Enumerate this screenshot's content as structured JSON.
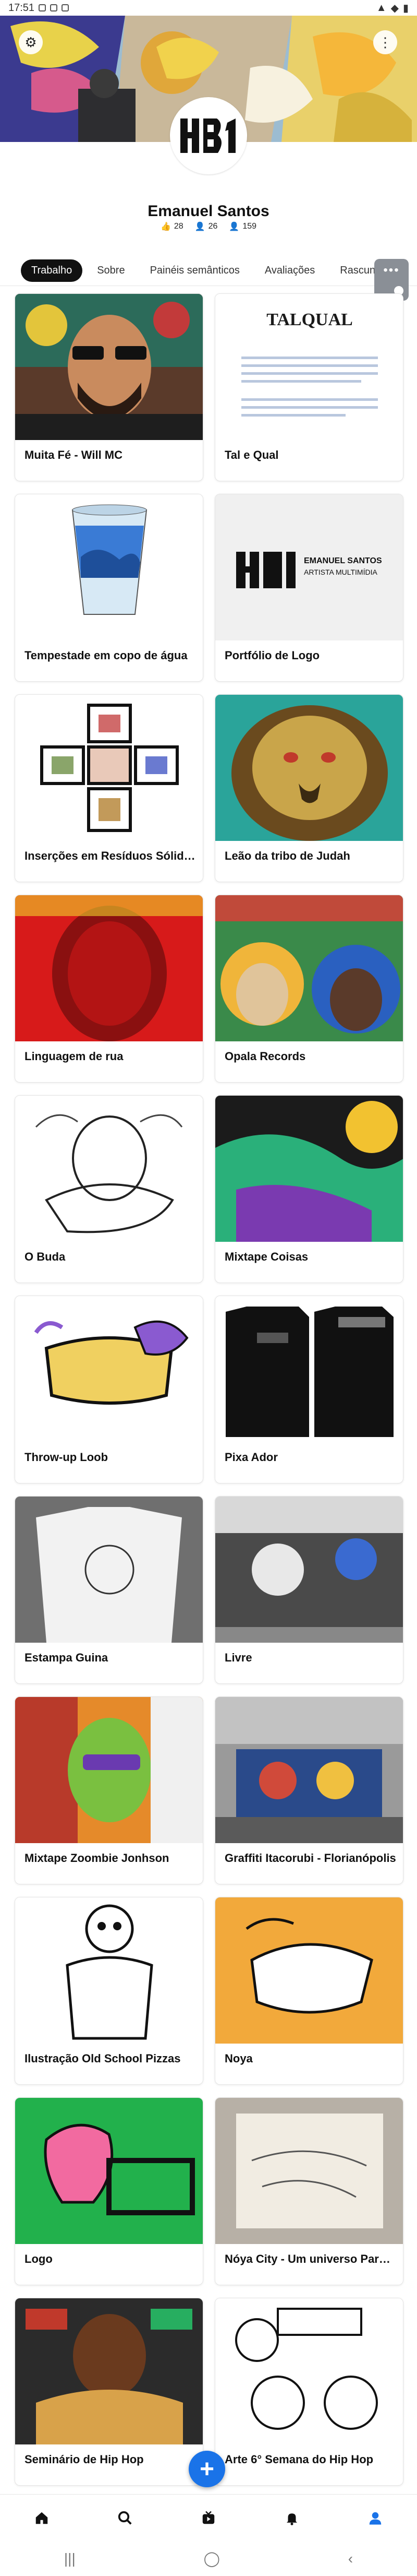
{
  "status_bar": {
    "time": "17:51"
  },
  "profile": {
    "name": "Emanuel Santos",
    "likes": "28",
    "followers": "26",
    "following": "159"
  },
  "tabs": [
    "Trabalho",
    "Sobre",
    "Painéis semânticos",
    "Avaliações",
    "Rascunhos"
  ],
  "projects": [
    "Muita Fé - Will MC",
    "Tal e Qual",
    "Tempestade em copo de água",
    "Portfólio de Logo",
    "Inserções em Resíduos Sólidos",
    "Leão da tribo de Judah",
    "Linguagem de rua",
    "Opala Records",
    "O Buda",
    "Mixtape Coisas",
    "Throw-up Loob",
    "Pixa Ador",
    "Estampa Guina",
    "Livre",
    "Mixtape Zoombie Jonhson",
    "Graffiti Itacorubi - Florianópolis",
    "Ilustração Old School Pizzas",
    "Noya",
    "Logo",
    "Nóya City - Um universo Paralelo",
    "Seminário de Hip Hop",
    "Arte 6° Semana do Hip Hop"
  ],
  "thumb_text": {
    "logo_mark": "HB1",
    "tal_qual": "TALQUAL",
    "portfolio_line1": "EMANUEL SANTOS",
    "portfolio_line2": "ARTISTA MULTIMÍDIA"
  },
  "icons": {
    "settings": "gear-icon",
    "more": "more-vert-icon",
    "home": "home-icon",
    "search": "search-icon",
    "live": "live-icon",
    "notifications": "bell-icon",
    "profile": "person-icon",
    "add": "plus-icon"
  },
  "colors": {
    "active_tab_bg": "#111111",
    "fab": "#1a73e8",
    "profile_nav_active": "#1a73e8"
  }
}
